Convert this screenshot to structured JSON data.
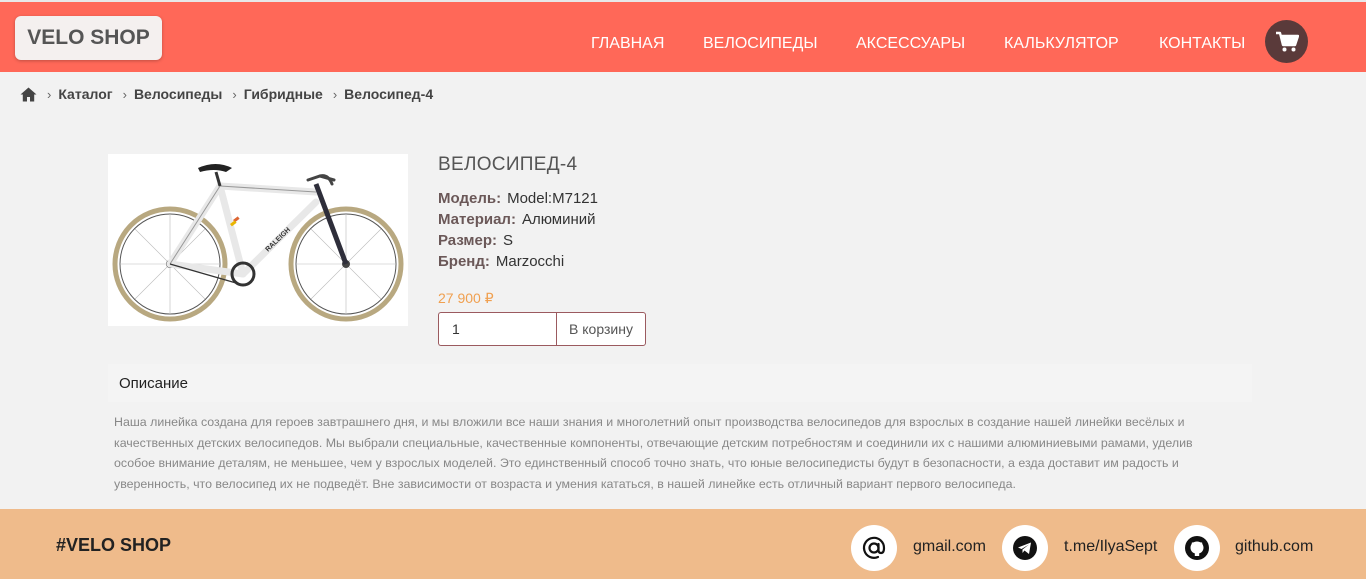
{
  "header": {
    "logo": "VELO SHOP",
    "nav": [
      "ГЛАВНАЯ",
      "ВЕЛОСИПЕДЫ",
      "АКСЕССУАРЫ",
      "КАЛЬКУЛЯТОР",
      "КОНТАКТЫ"
    ]
  },
  "breadcrumb": [
    "Каталог",
    "Велосипеды",
    "Гибридные",
    "Велосипед-4"
  ],
  "product": {
    "title": "ВЕЛОСИПЕД-4",
    "specs": [
      {
        "key": "Модель:",
        "value": "Model:M7121"
      },
      {
        "key": "Материал:",
        "value": "Алюминий"
      },
      {
        "key": "Размер:",
        "value": "S"
      },
      {
        "key": "Бренд:",
        "value": "Marzocchi"
      }
    ],
    "price": "27 900 ₽",
    "quantity": "1",
    "add_to_cart": "В корзину",
    "frame_text": "RALEIGH"
  },
  "description": {
    "tab": "Описание",
    "text": "Наша линейка создана для героев завтрашнего дня, и мы вложили все наши знания и многолетний опыт производства велосипедов для взрослых в создание нашей линейки весёлых и качественных детских велосипедов. Мы выбрали специальные, качественные компоненты, отвечающие детским потребностям и соединили их с нашими алюминиевыми рамами, уделив особое внимание деталям, не меньшее, чем у взрослых моделей. Это единственный способ точно знать, что юные велосипедисты будут в безопасности, а езда доставит им радость и уверенность, что велосипед их не подведёт. Вне зависимости от возраста и умения кататься, в нашей линейке есть отличный вариант первого велосипеда."
  },
  "footer": {
    "brand": "#VELO SHOP",
    "contacts": [
      {
        "icon": "at-icon",
        "label": "gmail.com"
      },
      {
        "icon": "telegram-icon",
        "label": "t.me/IlyaSept"
      },
      {
        "icon": "github-icon",
        "label": "github.com"
      }
    ]
  },
  "colors": {
    "header": "#ff6858",
    "footer": "#efbb8b",
    "price": "#f0a050",
    "cart": "#5a3a3a"
  }
}
